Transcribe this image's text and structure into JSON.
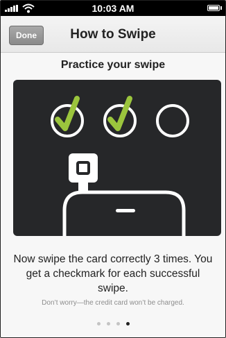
{
  "status_bar": {
    "time": "10:03 AM",
    "icons": [
      "signal-bars-icon",
      "wifi-icon",
      "battery-icon"
    ]
  },
  "nav": {
    "done_label": "Done",
    "title": "How to Swipe"
  },
  "subtitle": "Practice your swipe",
  "illustration": {
    "swipe_indicators": [
      {
        "state": "checked"
      },
      {
        "state": "checked"
      },
      {
        "state": "empty"
      }
    ],
    "colors": {
      "panel": "#262729",
      "check": "#9bc53d",
      "outline": "#ffffff"
    }
  },
  "instructions": "Now swipe the card correctly 3 times. You get a checkmark for each successful swipe.",
  "note": "Don’t worry—the credit card won’t be charged.",
  "pagination": {
    "total": 4,
    "current": 4
  }
}
